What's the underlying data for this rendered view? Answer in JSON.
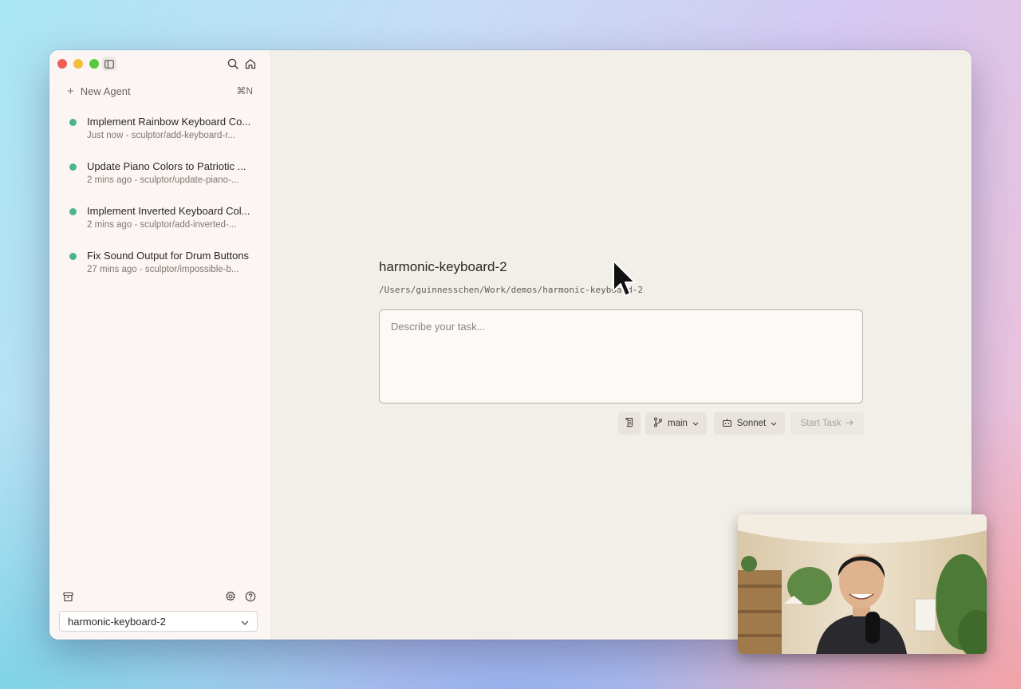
{
  "sidebar": {
    "new_agent_label": "New Agent",
    "new_agent_shortcut": "⌘N",
    "agents": [
      {
        "title": "Implement Rainbow Keyboard Co...",
        "subtitle": "Just now - sculptor/add-keyboard-r...",
        "status_color": "#4eb38a"
      },
      {
        "title": "Update Piano Colors to Patriotic ...",
        "subtitle": "2 mins ago - sculptor/update-piano-...",
        "status_color": "#4eb38a"
      },
      {
        "title": "Implement Inverted Keyboard Col...",
        "subtitle": "2 mins ago - sculptor/add-inverted-...",
        "status_color": "#4eb38a"
      },
      {
        "title": "Fix Sound Output for Drum Buttons",
        "subtitle": "27 mins ago - sculptor/impossible-b...",
        "status_color": "#4eb38a"
      }
    ],
    "repo_selector": "harmonic-keyboard-2"
  },
  "main": {
    "project_title": "harmonic-keyboard-2",
    "project_path": "/Users/guinnesschen/Work/demos/harmonic-keyboard-2",
    "task_placeholder": "Describe your task...",
    "branch_label": "main",
    "model_label": "Sonnet",
    "start_task_label": "Start Task"
  },
  "icons": {
    "sidebar_toggle": "sidebar-toggle-icon",
    "search": "search-icon",
    "home": "home-icon",
    "archive": "archive-icon",
    "settings": "gear-icon",
    "help": "help-icon"
  }
}
